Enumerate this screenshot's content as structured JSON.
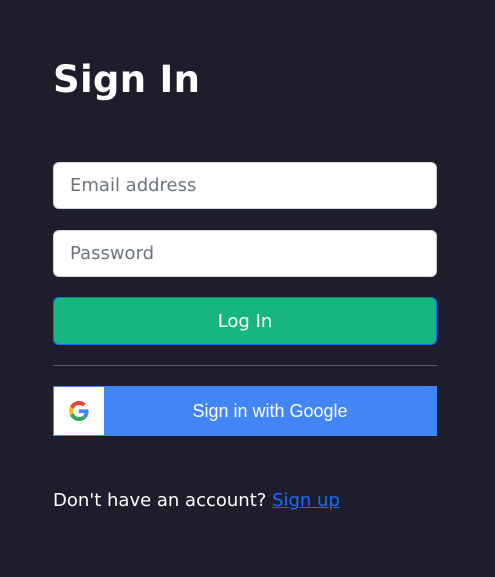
{
  "page": {
    "title": "Sign In"
  },
  "form": {
    "email": {
      "value": "",
      "placeholder": "Email address"
    },
    "password": {
      "value": "",
      "placeholder": "Password"
    },
    "login_label": "Log In",
    "google_label": "Sign in with Google"
  },
  "footer": {
    "prompt": "Don't have an account?",
    "signup_link": "Sign up"
  },
  "icons": {
    "google": "google-g-icon"
  },
  "colors": {
    "background": "#1e1d2b",
    "login_button": "#17b580",
    "google_button": "#4285f4",
    "link": "#1a6dff"
  }
}
